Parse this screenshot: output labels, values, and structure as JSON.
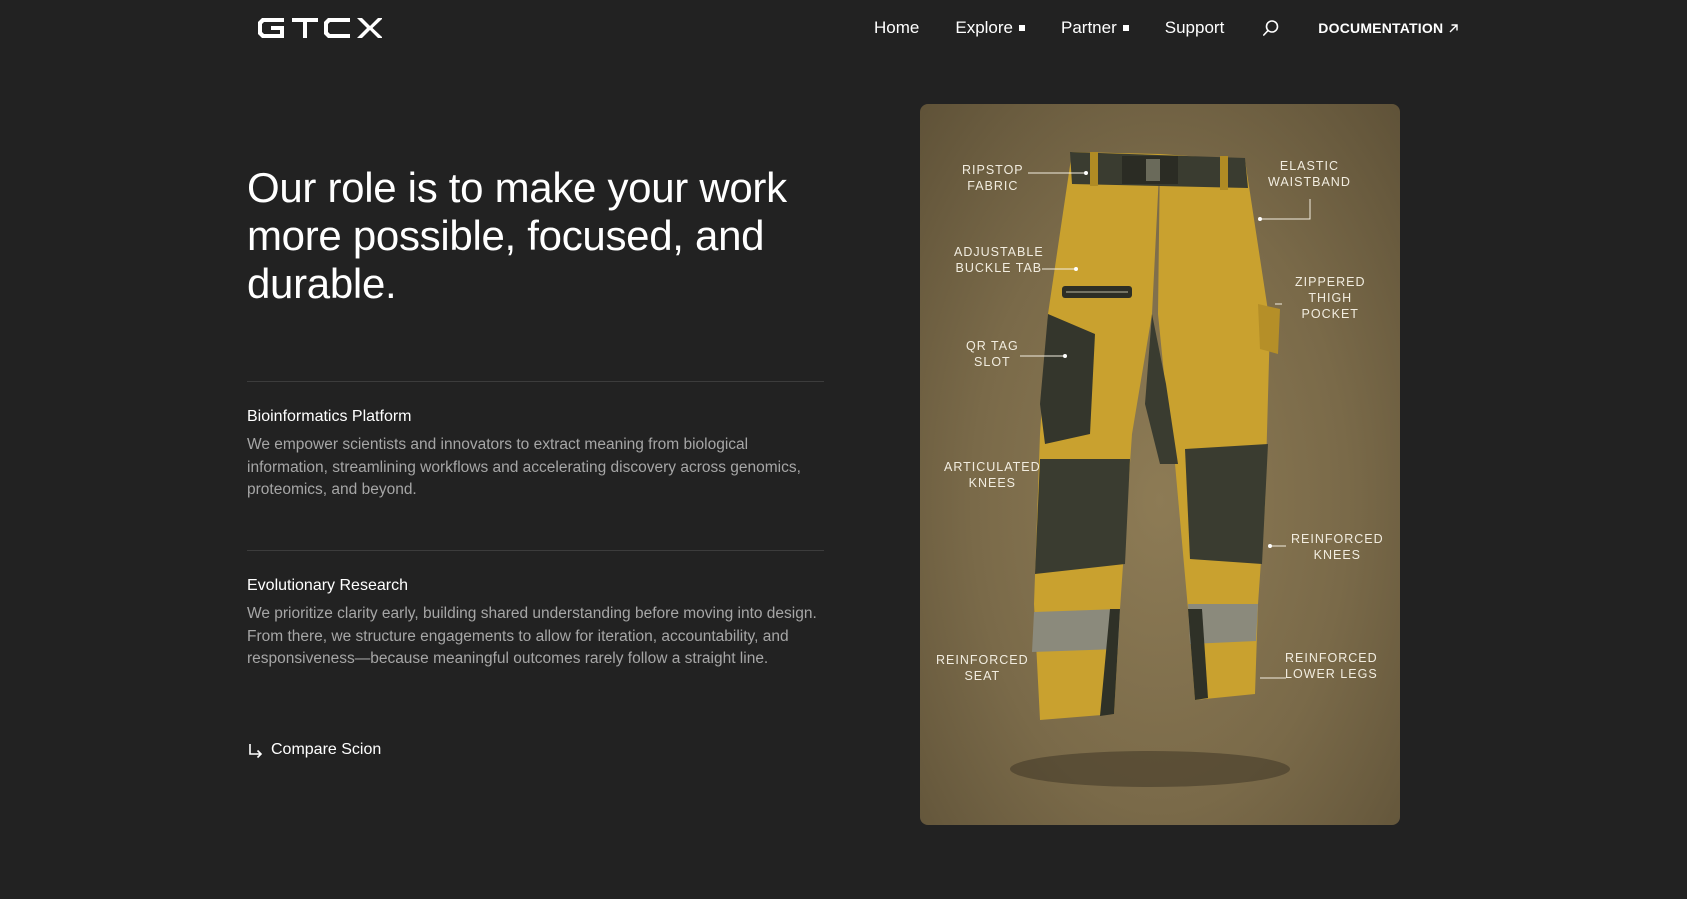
{
  "header": {
    "logo_text": "GTCX",
    "nav": [
      {
        "label": "Home",
        "has_menu": false
      },
      {
        "label": "Explore",
        "has_menu": true
      },
      {
        "label": "Partner",
        "has_menu": true
      },
      {
        "label": "Support",
        "has_menu": false
      }
    ],
    "search_icon": "search-icon",
    "doc_link": {
      "label": "DOCUMENTATION",
      "icon": "arrow-up-right-icon"
    }
  },
  "hero": {
    "headline": "Our role is to make your work more possible, focused, and durable."
  },
  "features": [
    {
      "title": "Bioinformatics Platform",
      "body": "We empower scientists and innovators to extract meaning from biological information, streamlining workflows and accelerating discovery across genomics, proteomics, and beyond."
    },
    {
      "title": "Evolutionary Research",
      "body": "We prioritize clarity early, building shared understanding before moving into design. From there, we structure engagements to allow for iteration, accountability, and responsiveness—because meaningful outcomes rarely follow a straight line."
    }
  ],
  "compare_link": {
    "label": "Compare Scion",
    "icon": "return-arrow-icon"
  },
  "product": {
    "callouts": {
      "ripstop": "RIPSTOP\nFABRIC",
      "elastic": "ELASTIC\nWAISTBAND",
      "buckle": "ADJUSTABLE\nBUCKLE TAB",
      "zip_pocket": "ZIPPERED\nTHIGH\nPOCKET",
      "qr_tag": "QR TAG\nSLOT",
      "artic_knees": "ARTICULATED\nKNEES",
      "reinf_knees": "REINFORCED\nKNEES",
      "reinf_seat": "REINFORCED\nSEAT",
      "reinf_lower": "REINFORCED\nLOWER LEGS"
    },
    "colors": {
      "primary": "#c9a12f",
      "panel": "#3a3c30",
      "reflective": "#8b8a7c",
      "background": "#7f6f4c"
    }
  },
  "colors": {
    "page_bg": "#222222",
    "text": "#ffffff",
    "muted": "#a6a6a6",
    "divider": "#3c3c3c"
  }
}
